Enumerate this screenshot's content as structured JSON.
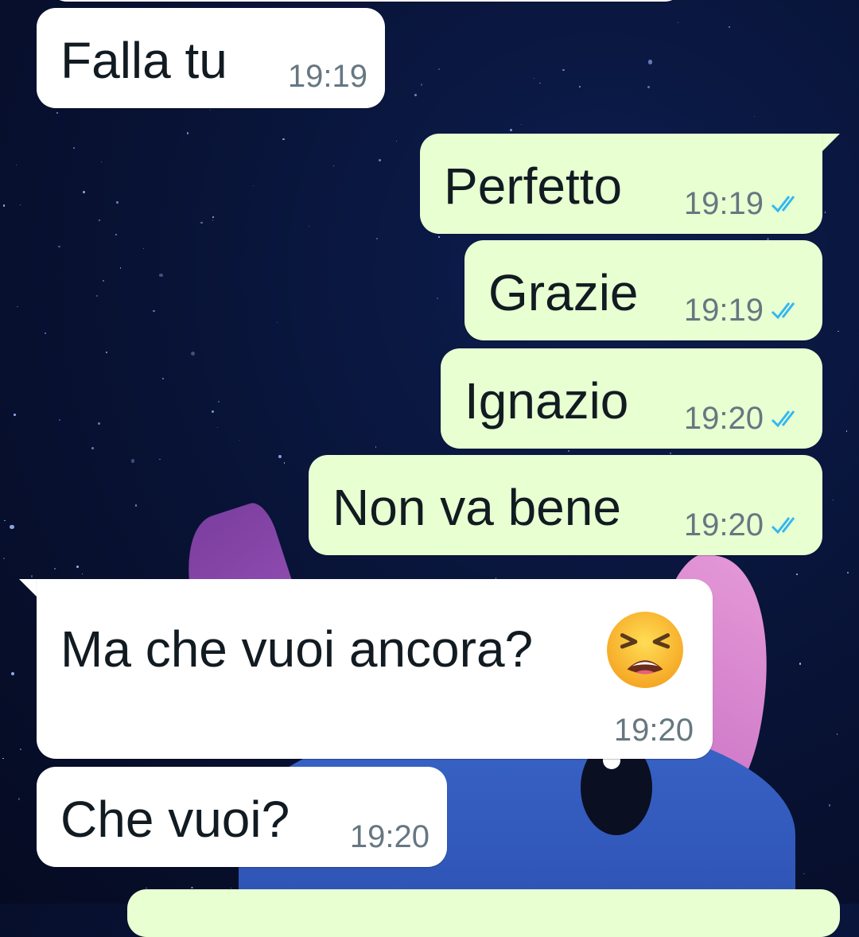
{
  "colors": {
    "incoming_bubble": "#ffffff",
    "outgoing_bubble": "#e8ffd2",
    "read_ticks": "#34b7f1",
    "text": "#111b21",
    "timestamp": "#667781"
  },
  "messages": [
    {
      "direction": "incoming",
      "text": "Falla tu",
      "time": "19:19"
    },
    {
      "direction": "outgoing",
      "text": "Perfetto",
      "time": "19:19",
      "status": "read",
      "status_icon": "double-check-icon"
    },
    {
      "direction": "outgoing",
      "text": "Grazie",
      "time": "19:19",
      "status": "read",
      "status_icon": "double-check-icon"
    },
    {
      "direction": "outgoing",
      "text": "Ignazio",
      "time": "19:20",
      "status": "read",
      "status_icon": "double-check-icon"
    },
    {
      "direction": "outgoing",
      "text": "Non va bene",
      "time": "19:20",
      "status": "read",
      "status_icon": "double-check-icon"
    },
    {
      "direction": "incoming",
      "text": "Ma che vuoi ancora?",
      "emoji": "tired-face-emoji",
      "time": "19:20"
    },
    {
      "direction": "incoming",
      "text": "Che vuoi?",
      "time": "19:20"
    }
  ]
}
